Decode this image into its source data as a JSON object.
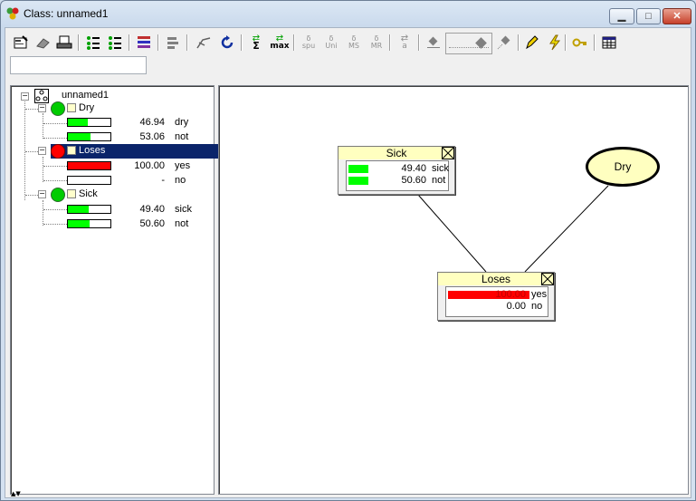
{
  "window": {
    "title": "Class: unnamed1",
    "controls": {
      "minimize": "▭",
      "maximize": "□",
      "close": "✕"
    }
  },
  "toolbar": {
    "icons": [
      "properties-icon",
      "eraser-icon",
      "print-icon",
      "node-list-icon-1",
      "node-list-icon-2",
      "color-bars-icon",
      "align-icon",
      "arrows-icon",
      "refresh-icon",
      "sum-propagate-icon",
      "max-propagate-icon",
      "spu-icon",
      "uni-icon",
      "ms-icon",
      "mr-icon",
      "arrow-a-icon",
      "zoom-out-icon",
      "zoom-in-icon",
      "pencil-icon",
      "lightning-icon",
      "key-icon",
      "grid-icon"
    ],
    "labels": {
      "sum": "Σ",
      "max": "max",
      "spu": "spu",
      "uni": "Uni",
      "ms": "MS",
      "mr": "MR",
      "a": "a",
      "delta": "δ"
    }
  },
  "search": {
    "value": "",
    "placeholder": ""
  },
  "tree": {
    "root": {
      "label": "unnamed1"
    },
    "nodes": [
      {
        "label": "Dry",
        "color": "#00cc00",
        "states": [
          {
            "value": "46.94",
            "name": "dry",
            "fill": 0.4694,
            "bar_color": "#00ff00"
          },
          {
            "value": "53.06",
            "name": "not",
            "fill": 0.5306,
            "bar_color": "#00ff00"
          }
        ]
      },
      {
        "label": "Loses",
        "color": "#ff0000",
        "selected": true,
        "states": [
          {
            "value": "100.00",
            "name": "yes",
            "fill": 1.0,
            "bar_color": "#ff0000"
          },
          {
            "value": "-",
            "name": "no",
            "fill": 0.0,
            "bar_color": "#ff0000"
          }
        ]
      },
      {
        "label": "Sick",
        "color": "#00cc00",
        "states": [
          {
            "value": "49.40",
            "name": "sick",
            "fill": 0.494,
            "bar_color": "#00ff00"
          },
          {
            "value": "50.60",
            "name": "not",
            "fill": 0.506,
            "bar_color": "#00ff00"
          }
        ]
      }
    ]
  },
  "canvas": {
    "sick": {
      "title": "Sick",
      "states": [
        {
          "value": "49.40",
          "name": "sick",
          "fill": 0.494
        },
        {
          "value": "50.60",
          "name": "not",
          "fill": 0.506
        }
      ]
    },
    "loses": {
      "title": "Loses",
      "states": [
        {
          "value": "100.00",
          "name": "yes",
          "fill": 1.0
        },
        {
          "value": "0.00",
          "name": "no",
          "fill": 0.0
        }
      ]
    },
    "dry": {
      "title": "Dry"
    }
  },
  "colors": {
    "selection": "#0a246a",
    "evidence": "#ff0000",
    "belief": "#00ff00",
    "node_header": "#ffffc0"
  }
}
